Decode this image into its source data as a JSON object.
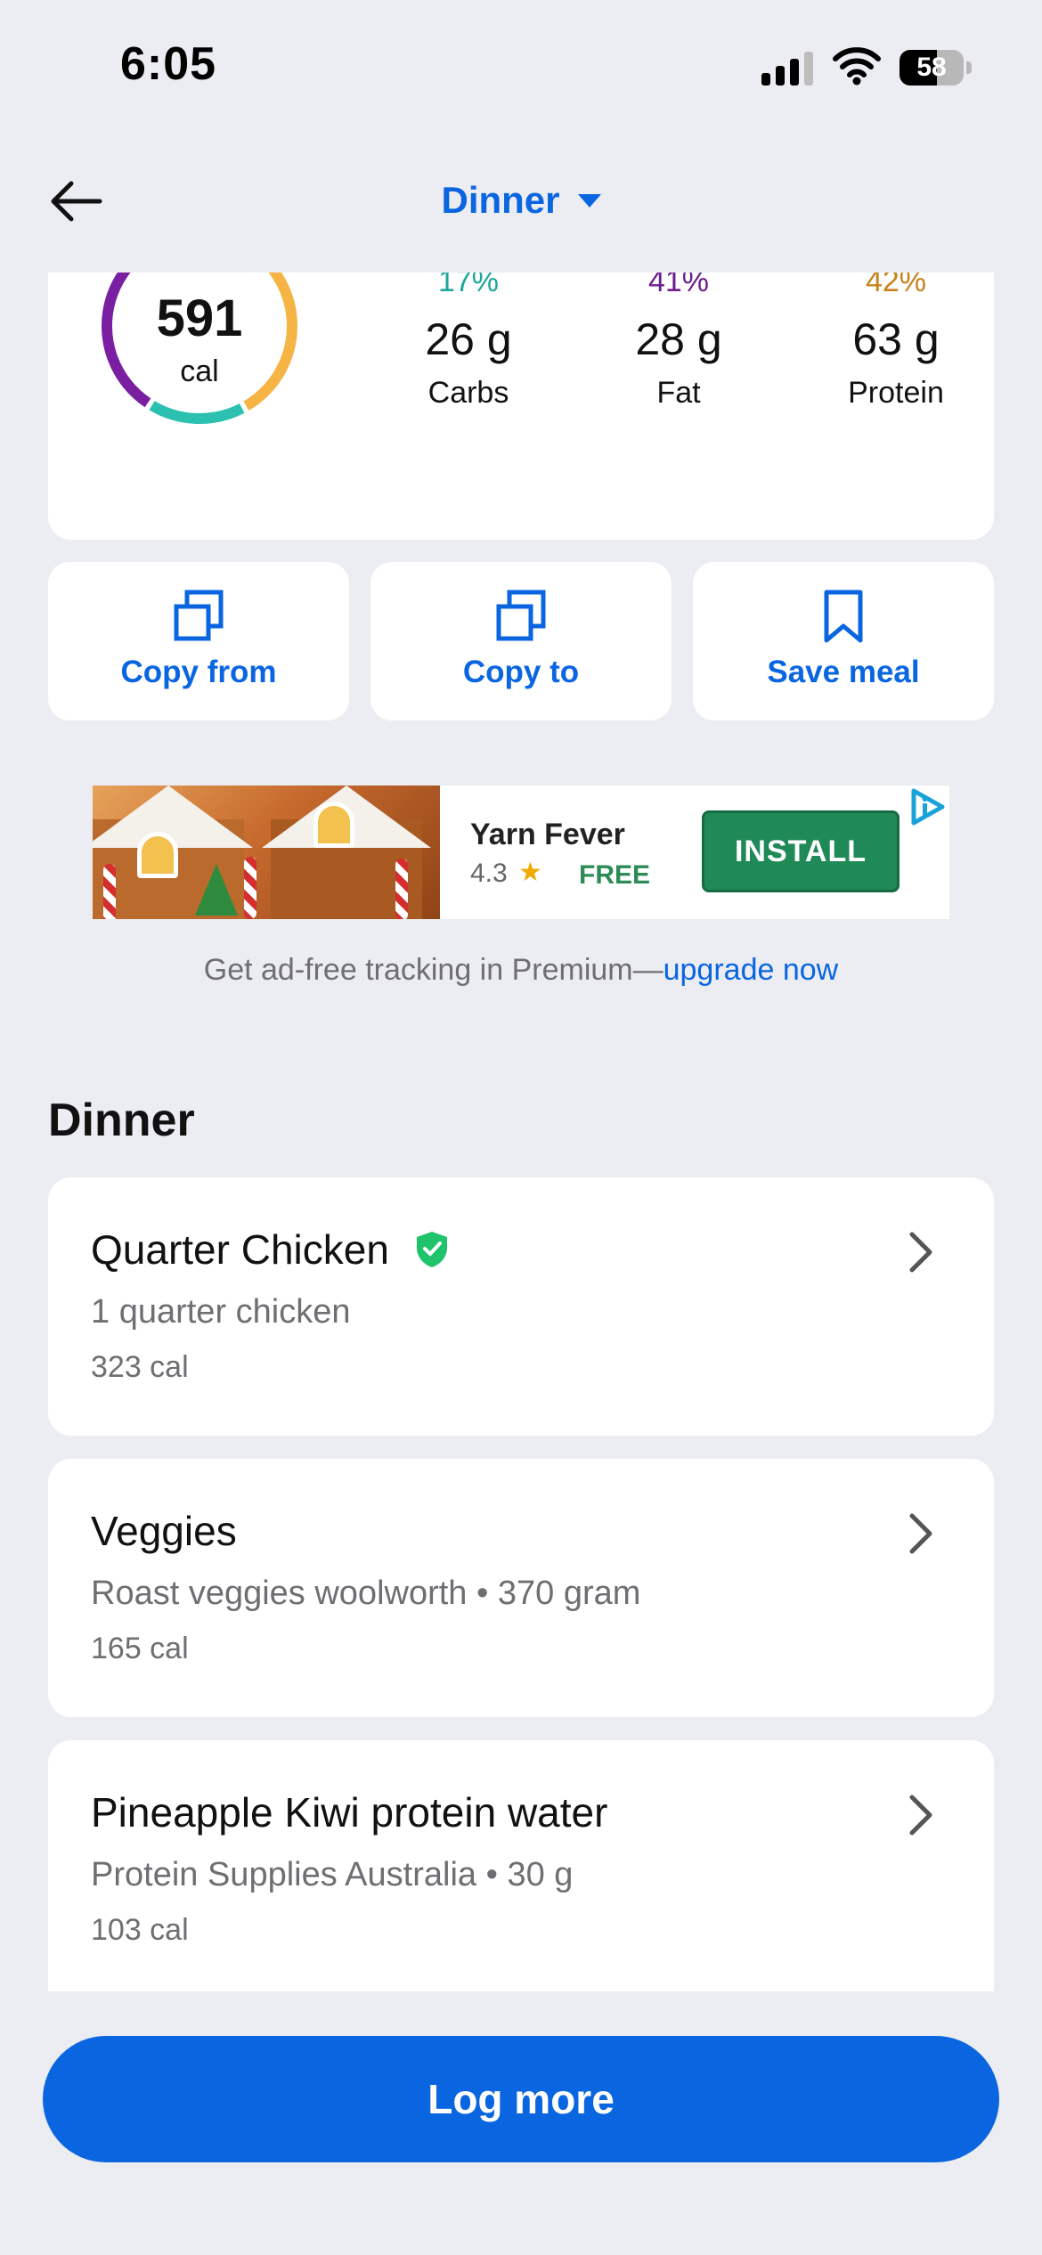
{
  "status_bar": {
    "time": "6:05",
    "battery": "58",
    "battery_level": 0.58,
    "icons": [
      "signal-icon",
      "wifi-icon",
      "battery-icon"
    ]
  },
  "nav": {
    "back_icon": "arrow-left-icon",
    "title": "Dinner",
    "title_icon": "caret-down-icon"
  },
  "summary": {
    "calories": "591",
    "calories_unit": "cal",
    "macros": [
      {
        "percent": "17%",
        "value": "26 g",
        "label": "Carbs",
        "color": "#1FA69A"
      },
      {
        "percent": "41%",
        "value": "28 g",
        "label": "Fat",
        "color": "#6E1E8C"
      },
      {
        "percent": "42%",
        "value": "63 g",
        "label": "Protein",
        "color": "#C7821A"
      }
    ],
    "ring_colors": {
      "carbs": "#2CC0B0",
      "fat": "#7A1FA2",
      "protein": "#F5B443"
    }
  },
  "actions": [
    {
      "label": "Copy from",
      "icon": "copy-icon"
    },
    {
      "label": "Copy to",
      "icon": "copy-icon"
    },
    {
      "label": "Save meal",
      "icon": "bookmark-icon"
    }
  ],
  "ad": {
    "title": "Yarn Fever",
    "rating": "4.3",
    "price": "FREE",
    "cta": "INSTALL",
    "choices_icon": "ad-choices-icon"
  },
  "ad_note": {
    "text": "Get ad-free tracking in Premium—",
    "link": "upgrade now"
  },
  "section_title": "Dinner",
  "foods": [
    {
      "name": "Quarter Chicken",
      "verified": true,
      "description": "1 quarter chicken",
      "calories": "323 cal"
    },
    {
      "name": "Veggies",
      "verified": false,
      "description": "Roast veggies woolworth • 370 gram",
      "calories": "165 cal"
    },
    {
      "name": "Pineapple Kiwi protein water",
      "verified": false,
      "description": "Protein Supplies Australia • 30 g",
      "calories": "103 cal"
    }
  ],
  "log_more": "Log more",
  "colors": {
    "accent": "#0A66E0",
    "background": "#ECEDF2",
    "verified": "#1FC46A"
  }
}
